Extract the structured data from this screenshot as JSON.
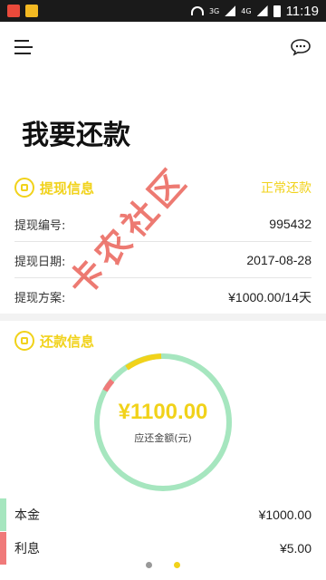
{
  "status_bar": {
    "time": "11:19",
    "signal_3g": "3G",
    "signal_4g": "4G"
  },
  "header": {
    "title": "我要还款"
  },
  "withdraw_info": {
    "section_title": "提现信息",
    "status": "正常还款",
    "rows": [
      {
        "label": "提现编号:",
        "value": "995432"
      },
      {
        "label": "提现日期:",
        "value": "2017-08-28"
      },
      {
        "label": "提现方案:",
        "value": "¥1000.00/14天"
      }
    ]
  },
  "repay_info": {
    "section_title": "还款信息",
    "amount": "¥1100.00",
    "amount_label": "应还金额(元)",
    "breakdown": [
      {
        "label": "本金",
        "value": "¥1000.00",
        "color": "#a6e6bf"
      },
      {
        "label": "利息",
        "value": "¥5.00",
        "color": "#f07a7a"
      }
    ]
  },
  "pager": {
    "count": 2,
    "active": 2
  },
  "watermark": {
    "text": "卡农社区"
  },
  "colors": {
    "accent": "#f1d21a",
    "principal": "#a6e6bf",
    "interest": "#f07a7a",
    "watermark": "#e6463c"
  }
}
